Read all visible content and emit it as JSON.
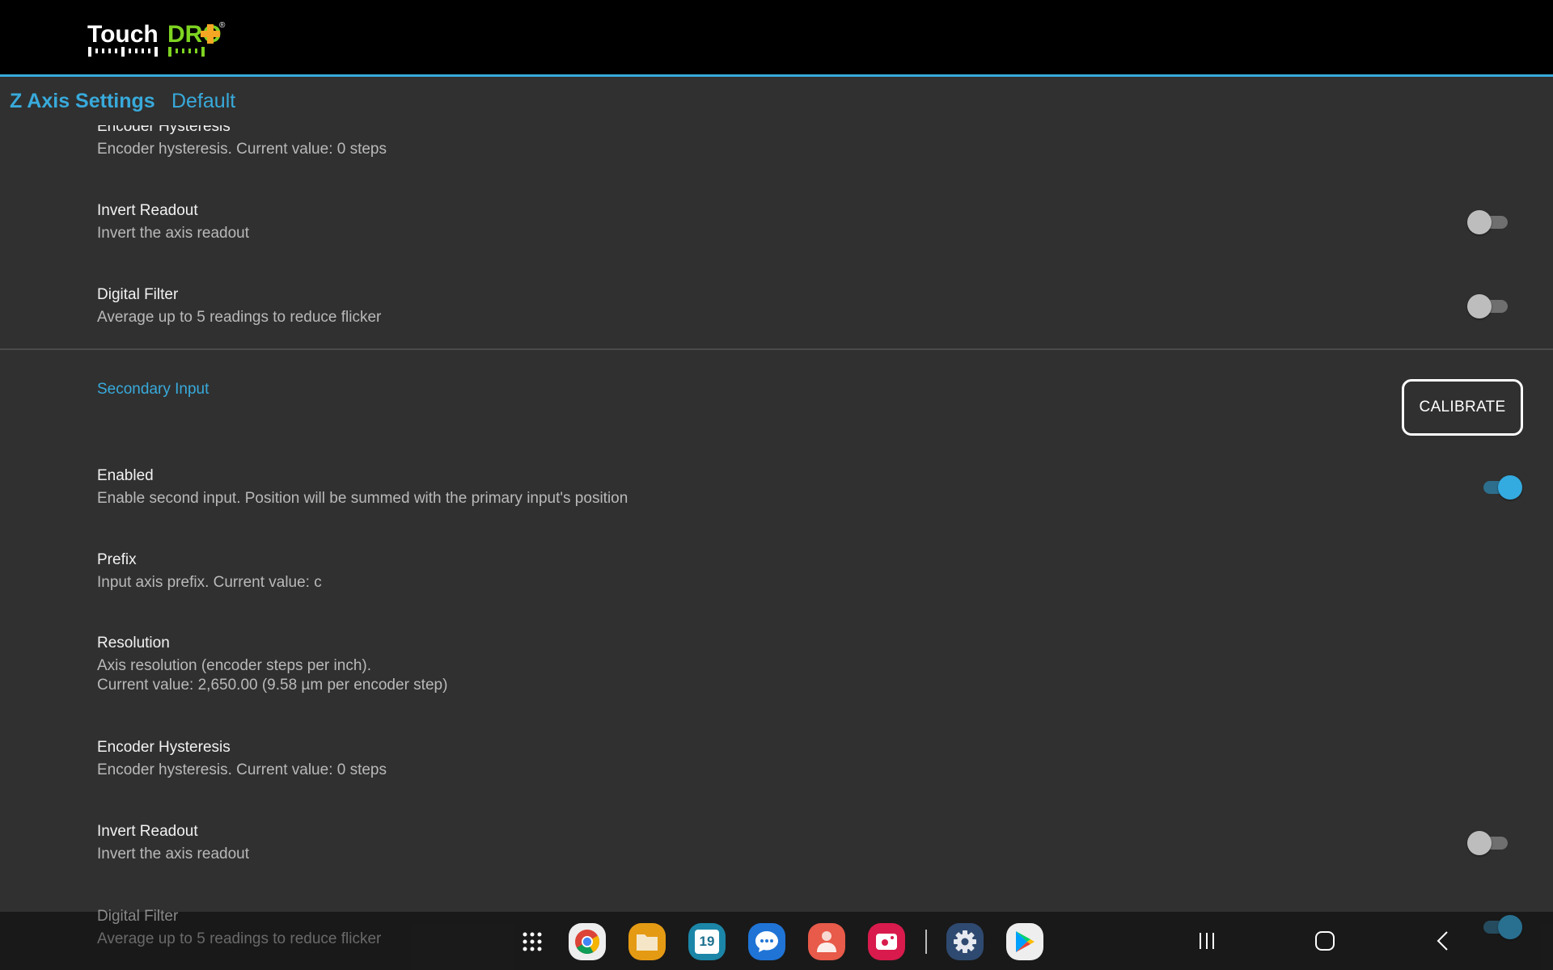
{
  "app": {
    "logo_text_white": "Touch",
    "logo_text_green": "DRO",
    "logo_plus": "+",
    "logo_registered": "®"
  },
  "header": {
    "title": "Z Axis Settings",
    "profile": "Default"
  },
  "primary_section": {
    "items": [
      {
        "title": "Encoder Hysteresis",
        "summary": "Encoder hysteresis. Current value: 0 steps"
      },
      {
        "title": "Invert Readout",
        "summary": "Invert the axis readout",
        "toggle": false
      },
      {
        "title": "Digital Filter",
        "summary": "Average up to 5 readings to reduce flicker",
        "toggle": false
      }
    ]
  },
  "secondary_section": {
    "category": "Secondary Input",
    "calibrate_label": "CALIBRATE",
    "items": [
      {
        "title": "Enabled",
        "summary": "Enable second input. Position will be summed with the primary input's position",
        "toggle": true
      },
      {
        "title": "Prefix",
        "summary": "Input axis prefix. Current value: c"
      },
      {
        "title": "Resolution",
        "summary": "Axis resolution (encoder steps per inch).",
        "summary2": "Current value: 2,650.00 (9.58 µm per encoder step)"
      },
      {
        "title": "Encoder Hysteresis",
        "summary": "Encoder hysteresis. Current value: 0 steps"
      },
      {
        "title": "Invert Readout",
        "summary": "Invert the axis readout",
        "toggle": false
      },
      {
        "title": "Digital Filter",
        "summary": "Average up to 5 readings to reduce flicker",
        "toggle": true
      }
    ]
  },
  "taskbar": {
    "apps": [
      "app-drawer",
      "chrome",
      "my-files",
      "calendar",
      "messages",
      "contacts",
      "screen-recorder",
      "settings",
      "play-store"
    ],
    "calendar_day": "19"
  },
  "colors": {
    "accent": "#38aadb",
    "logo_green": "#7ed321",
    "logo_orange": "#f5a623",
    "background": "#303030"
  }
}
